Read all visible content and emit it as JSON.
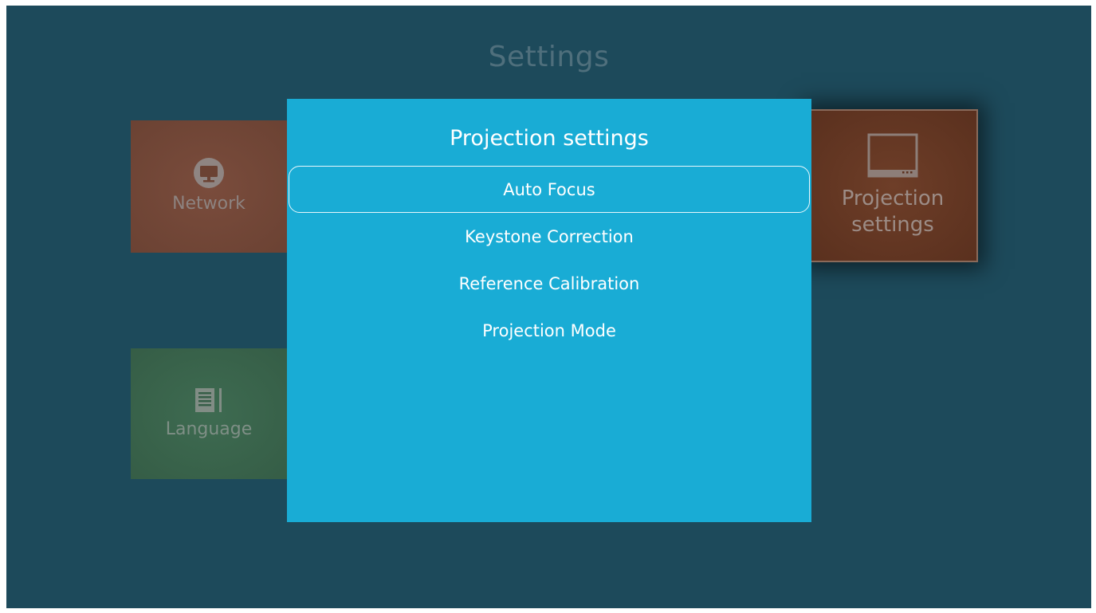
{
  "page": {
    "title": "Settings"
  },
  "tiles": {
    "network": {
      "label": "Network",
      "icon": "monitor-icon",
      "color": "#7a4c3c"
    },
    "language": {
      "label": "Language",
      "icon": "document-icon",
      "color": "#3e6b51"
    },
    "projection": {
      "label_line1": "Projection",
      "label_line2": "settings",
      "icon": "projector-screen-icon",
      "color": "#6e3e28"
    }
  },
  "dialog": {
    "title": "Projection settings",
    "background": "#19acd5",
    "items": [
      {
        "label": "Auto Focus",
        "selected": true
      },
      {
        "label": "Keystone Correction",
        "selected": false
      },
      {
        "label": "Reference Calibration",
        "selected": false
      },
      {
        "label": "Projection Mode",
        "selected": false
      }
    ]
  },
  "colors": {
    "background": "#1d4a5b",
    "accent": "#19acd5"
  }
}
